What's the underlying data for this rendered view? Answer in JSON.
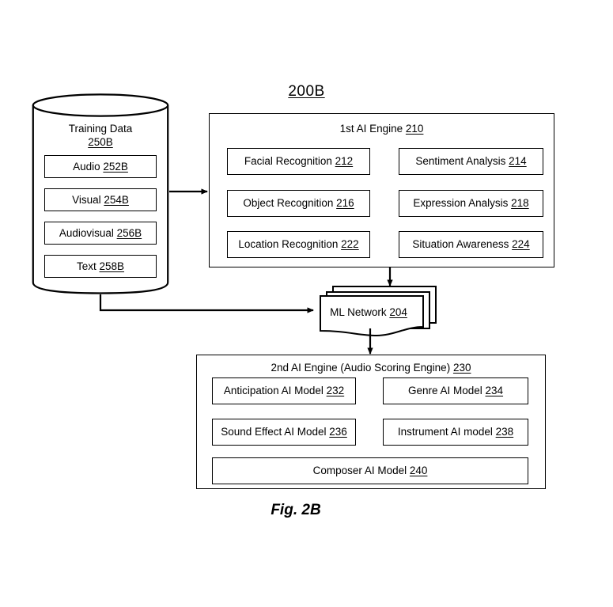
{
  "figure": {
    "number": "200B",
    "caption": "Fig. 2B"
  },
  "training_data": {
    "title": "Training Data",
    "ref": "250B",
    "items": [
      {
        "label": "Audio ",
        "ref": "252B"
      },
      {
        "label": "Visual ",
        "ref": "254B"
      },
      {
        "label": "Audiovisual ",
        "ref": "256B"
      },
      {
        "label": "Text ",
        "ref": "258B"
      }
    ]
  },
  "engine1": {
    "title": "1st AI Engine ",
    "ref": "210",
    "modules": [
      {
        "label": "Facial Recognition ",
        "ref": "212"
      },
      {
        "label": "Sentiment Analysis ",
        "ref": "214"
      },
      {
        "label": "Object Recognition ",
        "ref": "216"
      },
      {
        "label": "Expression Analysis ",
        "ref": "218"
      },
      {
        "label": "Location Recognition ",
        "ref": "222"
      },
      {
        "label": "Situation Awareness ",
        "ref": "224"
      }
    ]
  },
  "ml_network": {
    "label": "ML Network ",
    "ref": "204"
  },
  "engine2": {
    "title": "2nd AI Engine (Audio Scoring Engine) ",
    "ref": "230",
    "modules": [
      {
        "label": "Anticipation AI Model ",
        "ref": "232"
      },
      {
        "label": "Genre AI Model ",
        "ref": "234"
      },
      {
        "label": "Sound Effect AI Model ",
        "ref": "236"
      },
      {
        "label": "Instrument AI model ",
        "ref": "238"
      },
      {
        "label": "Composer AI Model ",
        "ref": "240"
      }
    ]
  },
  "colors": {
    "stroke": "#000000",
    "background": "#ffffff"
  }
}
